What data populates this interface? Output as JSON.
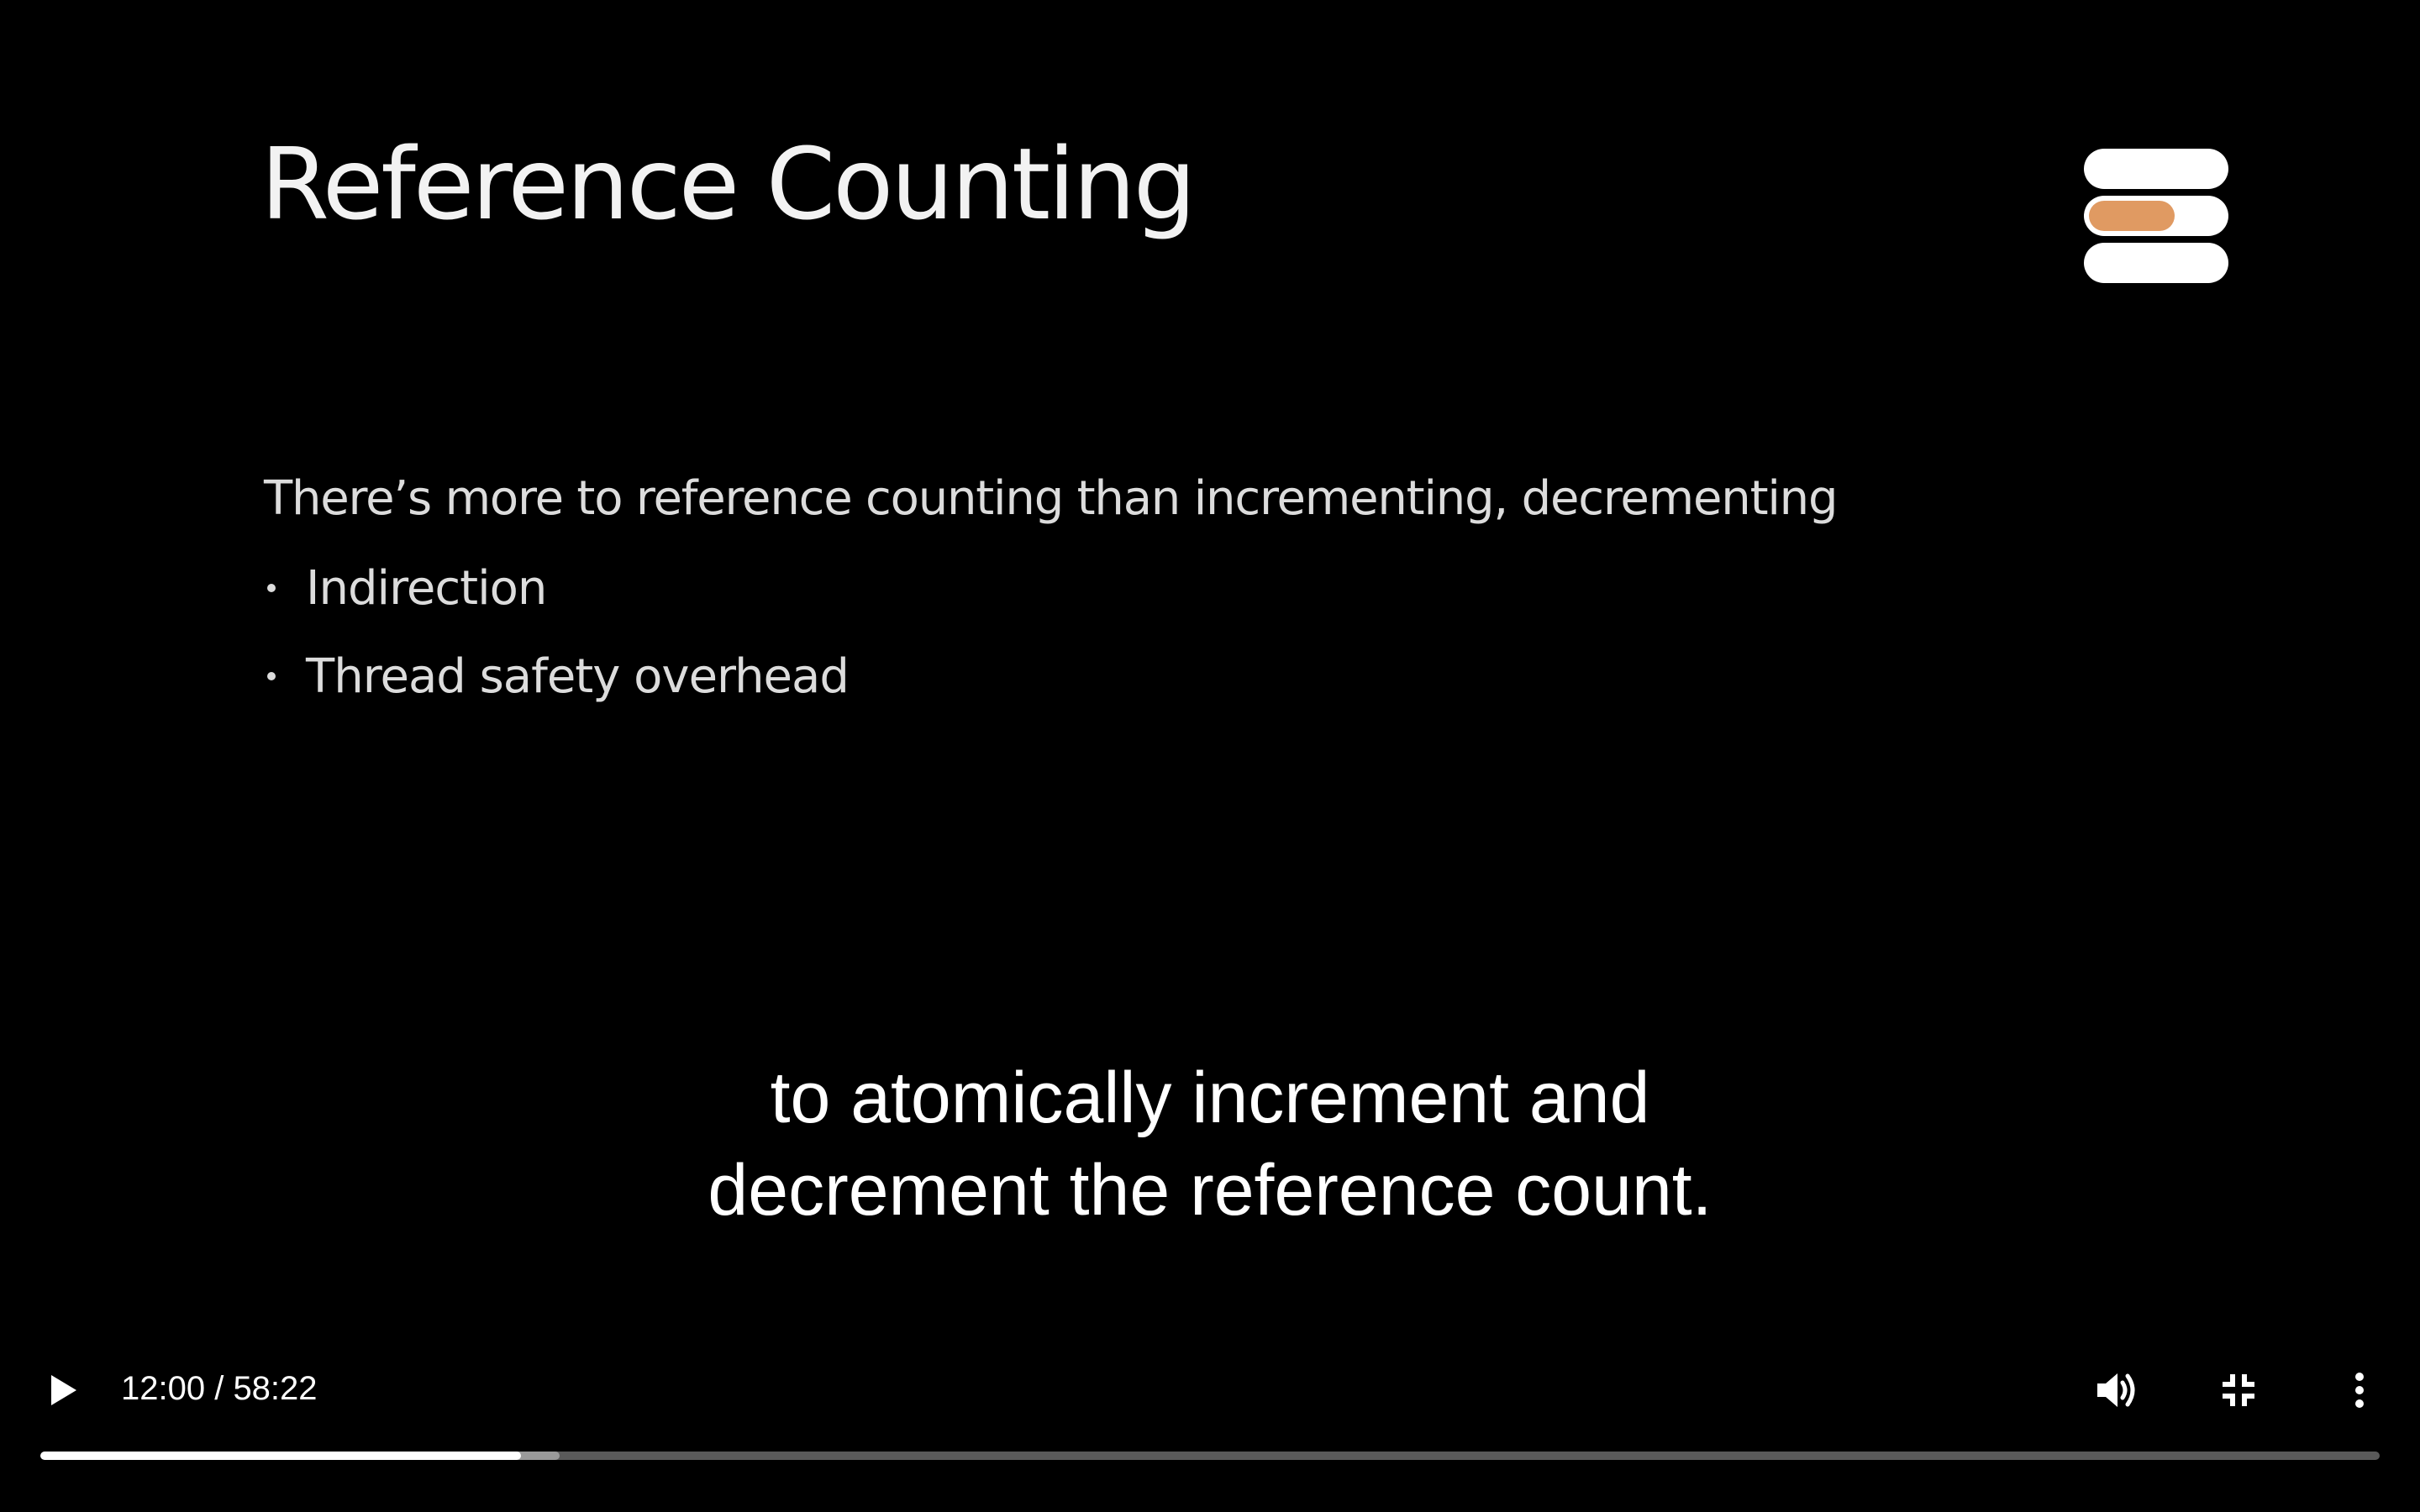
{
  "slide": {
    "title": "Reference Counting",
    "intro": "There’s more to reference counting than incrementing, decrementing",
    "bullets": [
      "Indirection",
      "Thread safety overhead"
    ],
    "logo_icon": "stacked-pills-logo",
    "logo_accent_color": "#e09a62"
  },
  "captions": {
    "line1": "to atomically increment and",
    "line2": "decrement the reference count."
  },
  "controls": {
    "time_display": "12:00 / 58:22",
    "current_time": "12:00",
    "duration": "58:22",
    "played_fraction": 0.2055,
    "buffered_fraction": 0.222,
    "play_icon": "play-icon",
    "volume_icon": "volume-icon",
    "fullscreen_icon": "exit-fullscreen-icon",
    "more_icon": "more-options-icon"
  }
}
